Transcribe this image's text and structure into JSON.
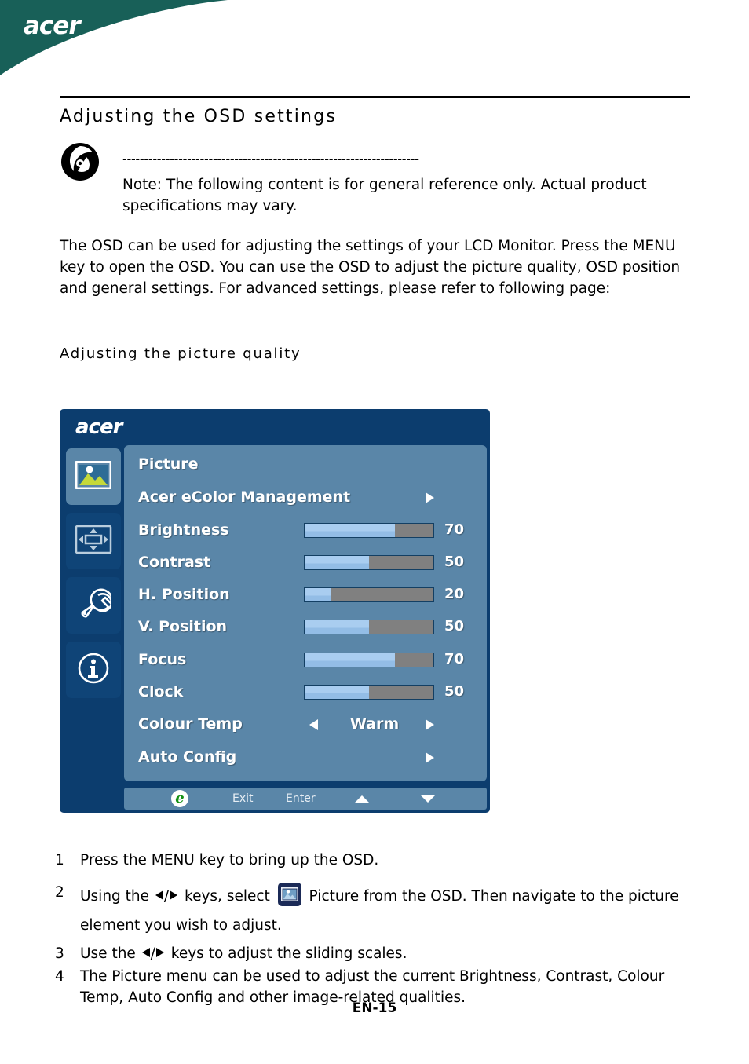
{
  "brand": {
    "name": "acer",
    "header_green": "#186058"
  },
  "page": {
    "heading": "Adjusting  the  OSD  settings",
    "sub_heading": "Adjusting  the  picture  quality",
    "footer": "EN-15",
    "note_dashes": "---------------------------------------------------------------------",
    "note_text": "Note: The following content is for general reference only. Actual product specifications may vary.",
    "body_paragraph": "The OSD can be used for adjusting the settings of your LCD Monitor. Press the MENU key to open the OSD. You can use the OSD to adjust the picture quality, OSD position and general settings. For advanced settings, please refer to following page:"
  },
  "osd": {
    "logo": "acer",
    "sidebar": [
      {
        "name": "picture-icon",
        "active": true
      },
      {
        "name": "osd-position-icon",
        "active": false
      },
      {
        "name": "setting-icon",
        "active": false
      },
      {
        "name": "information-icon",
        "active": false
      }
    ],
    "menu_title": "Picture",
    "rows": [
      {
        "label": "Acer eColor Management",
        "type": "submenu"
      },
      {
        "label": "Brightness",
        "type": "slider",
        "value": 70
      },
      {
        "label": "Contrast",
        "type": "slider",
        "value": 50
      },
      {
        "label": "H. Position",
        "type": "slider",
        "value": 20
      },
      {
        "label": "V. Position",
        "type": "slider",
        "value": 50
      },
      {
        "label": "Focus",
        "type": "slider",
        "value": 70
      },
      {
        "label": "Clock",
        "type": "slider",
        "value": 50
      },
      {
        "label": "Colour Temp",
        "type": "option",
        "value": "Warm"
      },
      {
        "label": "Auto Config",
        "type": "submenu"
      }
    ],
    "footer": {
      "logo_letter": "e",
      "exit": "Exit",
      "enter": "Enter",
      "up": "up-arrow",
      "down": "down-arrow"
    },
    "colors": {
      "frame": "#0c3d6e",
      "panel": "#5a86a8",
      "slider_fill": "#a9cdf0",
      "slider_track": "#808080",
      "icon_button": "#0f4477",
      "icon_button_active": "#5a86a8"
    }
  },
  "steps": [
    {
      "num": "1",
      "text_1": "Press the MENU key to bring up the OSD.",
      "text_2": "",
      "text_3": ""
    },
    {
      "num": "2",
      "text_1": "Using the ",
      "text_2": " keys, select ",
      "text_3": " Picture from the OSD. Then navigate to the picture element you wish to adjust."
    },
    {
      "num": "3",
      "text_1": "Use the ",
      "text_2": " keys to adjust the sliding scales.",
      "text_3": ""
    },
    {
      "num": "4",
      "text_1": "The Picture menu can be used to adjust the current Brightness, Contrast, Colour Temp, Auto Config and other image-related qualities.",
      "text_2": "",
      "text_3": ""
    }
  ]
}
